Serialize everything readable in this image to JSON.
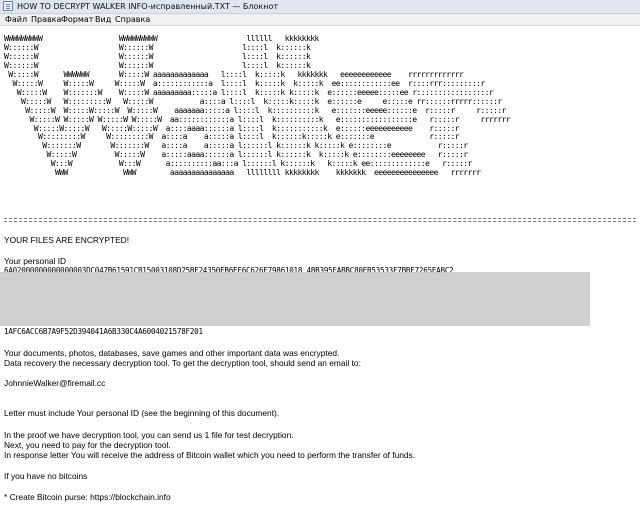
{
  "window": {
    "title": "HOW TO DECRYPT WALKER INFO-исправленный.TXT — Блокнот"
  },
  "menu": {
    "items": [
      "Файл",
      "Правка",
      "Формат",
      "Вид",
      "Справка"
    ]
  },
  "document": {
    "ascii_art": "WWWWWWWWW                  WWWWWWWWW                     llllll   kkkkkkkk\nW::::::W                   W::::::W                     l::::l  k::::::k\nW::::::W                   W::::::W                     l::::l  k::::::k\nW::::::W                   W::::::W                     l::::l  k::::::k\n W:::::W      WWWWWW       W:::::W aaaaaaaaaaaaa   l::::l  k:::::k   kkkkkkk   eeeeeeeeeeee    rrrrrrrrrrrrr\n  W:::::W     W:::::W     W:::::W  a::::::::::::a  l::::l  k:::::k  k:::::k  ee::::::::::::ee  r::::rrr:::::::::r\n   W:::::W    W:::::::W    W:::::W aaaaaaaaa:::::a l::::l  k:::::k k:::::k  e::::::eeeee:::::ee r:::::::::::::::::r\n    W:::::W   W:::::::::W   W:::::W           a::::a l::::l  k:::::k:::::k  e::::::e     e:::::e rr::::::rrrrr::::::r\n     W:::::W  W:::::W:::::W  W:::::W    aaaaaaa:::::a l::::l  k::::::::::k   e:::::::eeeee::::::e  r:::::r     r:::::r\n      W:::::W W:::::W W:::::W W:::::W  aa::::::::::::a l::::l  k::::::::::k   e:::::::::::::::::e   r:::::r     rrrrrrr\n       W:::::W:::::W   W:::::W:::::W  a::::aaaa::::::a l::::l  k:::::::::::k  e::::::eeeeeeeeeee    r:::::r\n        W:::::::::W     W:::::::::W  a::::a    a:::::a l::::l  k::::::k:::::k e:::::::e             r:::::r\n         W:::::::W       W:::::::W   a::::a    a:::::a l::::::l k::::::k k:::::k e::::::::e           r:::::r\n          W:::::W         W:::::W    a:::::aaaa::::::a l::::::l k::::::k  k:::::k e::::::::eeeeeeee   r:::::r\n           W:::W           W:::W      a::::::::::aa:::a l::::::l k::::::k   k:::::k ee:::::::::::::e   r:::::r\n            WWW             WWW        aaaaaaaaaaaaaaa   llllllll kkkkkkkk    kkkkkkk  eeeeeeeeeeeeeee   rrrrrrr",
    "heading": "YOUR FILES ARE ENCRYPTED!",
    "id_label": "Your personal ID",
    "id_first_line": "6A02000000000000003DC047B61591CB15003108D25BF24350EB6EF6C626F79861018 4BB395EABBC80EB53533F7BBE7265EABC2",
    "id_last_line": "1AFC6ACC6B7A9F52D394041A6B330C4A6004021578F201",
    "paragraph1_line1": "Your documents, photos, databases, save games and other important data was encrypted.",
    "paragraph1_line2": "Data recovery the necessary decryption tool. To get the decryption tool, should send an email to:",
    "email": "JohnnieWalker@firemail.cc",
    "letter_note": "Letter must include Your personal ID (see the beginning of this document).",
    "proof_line1": "In the proof we have decryption tool, you can send us 1 file for test decryption.",
    "proof_line2": "Next, you need to pay for the decryption tool.",
    "proof_line3": "In response letter You will receive the address of Bitcoin wallet which you need to perform the transfer of funds.",
    "no_bitcoins": "If you have no bitcoins",
    "create_purse": "* Create Bitcoin purse: https://blockchain.info"
  }
}
